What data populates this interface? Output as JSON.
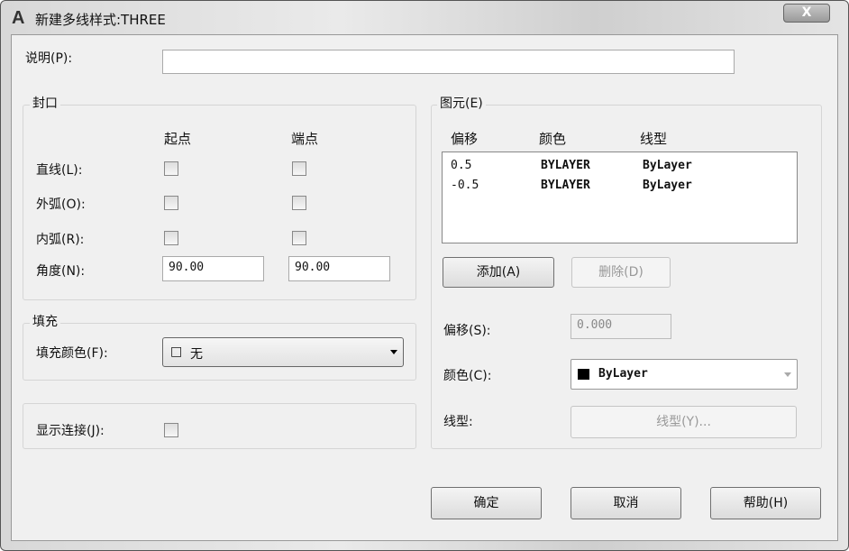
{
  "window": {
    "title": "新建多线样式:THREE",
    "logo": "A",
    "close": "X"
  },
  "description": {
    "label": "说明(P):",
    "value": ""
  },
  "caps": {
    "title": "封口",
    "col_start": "起点",
    "col_end": "端点",
    "rows": [
      {
        "label": "直线(L):"
      },
      {
        "label": "外弧(O):"
      },
      {
        "label": "内弧(R):"
      }
    ],
    "angle_label": "角度(N):",
    "angle_start": "90.00",
    "angle_end": "90.00"
  },
  "fill": {
    "title": "填充",
    "color_label": "填充颜色(F):",
    "color_value": "无",
    "swatch": "□"
  },
  "joints": {
    "label": "显示连接(J):"
  },
  "elements": {
    "title": "图元(E)",
    "headers": [
      "偏移",
      "颜色",
      "线型"
    ],
    "rows": [
      {
        "offset": "0.5",
        "color": "BYLAYER",
        "linetype": "ByLayer"
      },
      {
        "offset": "-0.5",
        "color": "BYLAYER",
        "linetype": "ByLayer"
      }
    ],
    "add": "添加(A)",
    "delete": "删除(D)",
    "offset_label": "偏移(S):",
    "offset_value": "0.000",
    "color_label": "颜色(C):",
    "color_value": "ByLayer",
    "linetype_label": "线型:",
    "linetype_button": "线型(Y)..."
  },
  "footer": {
    "ok": "确定",
    "cancel": "取消",
    "help": "帮助(H)"
  }
}
